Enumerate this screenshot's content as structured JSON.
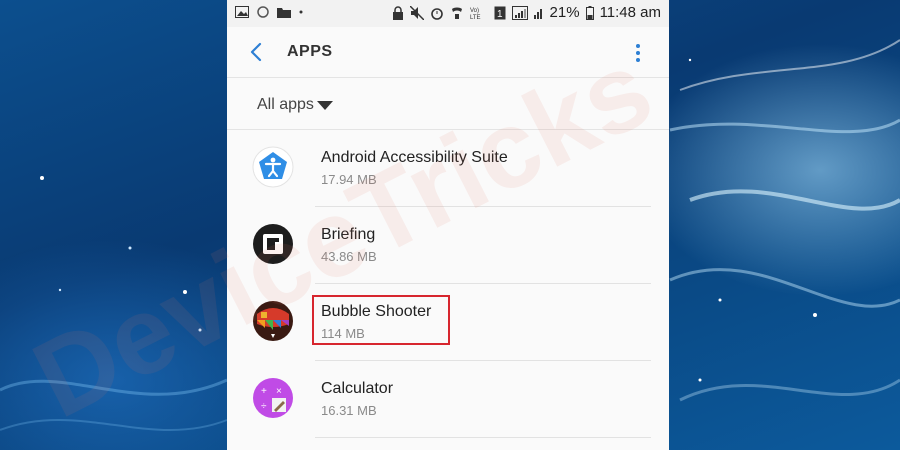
{
  "status_bar": {
    "battery_percent": "21%",
    "time": "11:48 am",
    "network": "Vo) LTE",
    "sim": "1"
  },
  "header": {
    "title": "APPS"
  },
  "filter": {
    "label": "All apps"
  },
  "apps": [
    {
      "name": "Android Accessibility Suite",
      "size": "17.94 MB",
      "icon": "accessibility-icon"
    },
    {
      "name": "Briefing",
      "size": "43.86 MB",
      "icon": "briefing-icon"
    },
    {
      "name": "Bubble Shooter",
      "size": "114 MB",
      "icon": "bubble-shooter-icon",
      "highlighted": true
    },
    {
      "name": "Calculator",
      "size": "16.31 MB",
      "icon": "calculator-icon"
    }
  ],
  "watermark": "DeviceTricks",
  "colors": {
    "highlight": "#d7262e",
    "accessibility_blue": "#2f8ee6",
    "calculator_purple": "#b23cde"
  }
}
